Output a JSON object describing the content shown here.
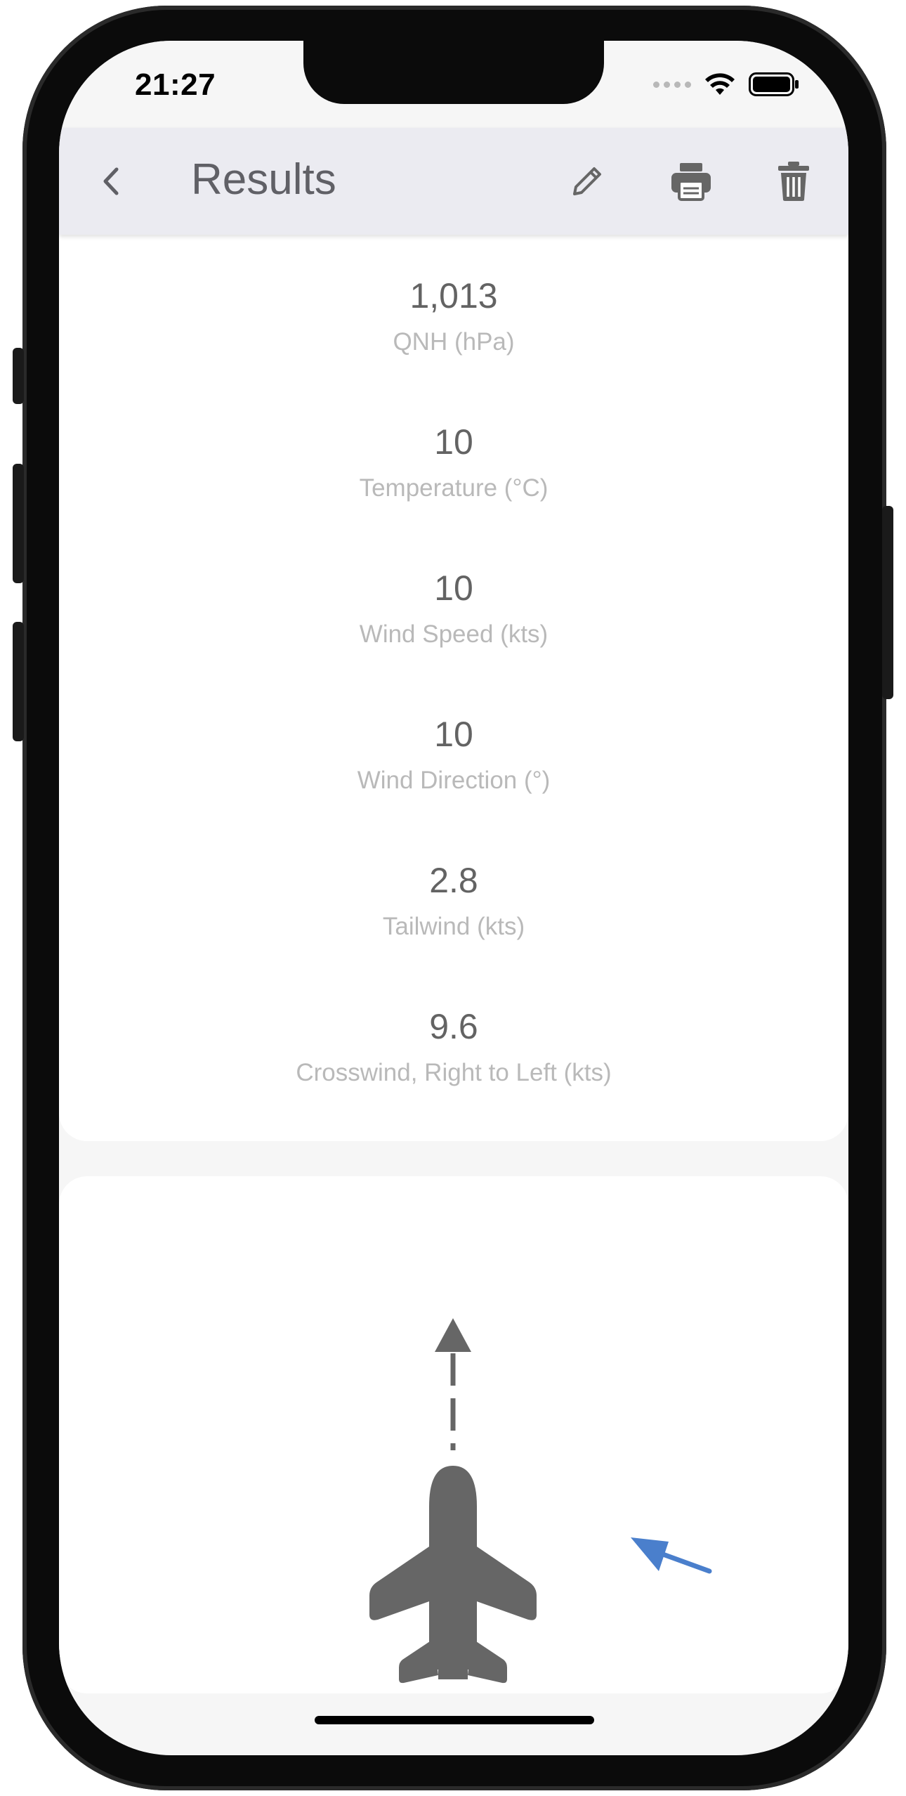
{
  "status_bar": {
    "time": "21:27",
    "icons": [
      "cellular-icon",
      "wifi-icon",
      "battery-icon"
    ]
  },
  "app_bar": {
    "title": "Results",
    "actions": [
      "back-icon",
      "pencil-icon",
      "printer-icon",
      "trash-icon"
    ]
  },
  "results": [
    {
      "value": "1,013",
      "label": "QNH (hPa)"
    },
    {
      "value": "10",
      "label": "Temperature (°C)"
    },
    {
      "value": "10",
      "label": "Wind Speed (kts)"
    },
    {
      "value": "10",
      "label": "Wind Direction (°)"
    },
    {
      "value": "2.8",
      "label": "Tailwind (kts)"
    },
    {
      "value": "9.6",
      "label": "Crosswind, Right to Left (kts)"
    }
  ],
  "wind_diagram": {
    "aircraft_heading": "up",
    "wind_arrow_color": "#4a7fcc"
  },
  "colors": {
    "accent_wind": "#4a7fcc",
    "icon_gray": "#666666",
    "value_text": "#636363",
    "label_text": "#b9b9b9",
    "app_bar_bg": "#ebebf1"
  }
}
